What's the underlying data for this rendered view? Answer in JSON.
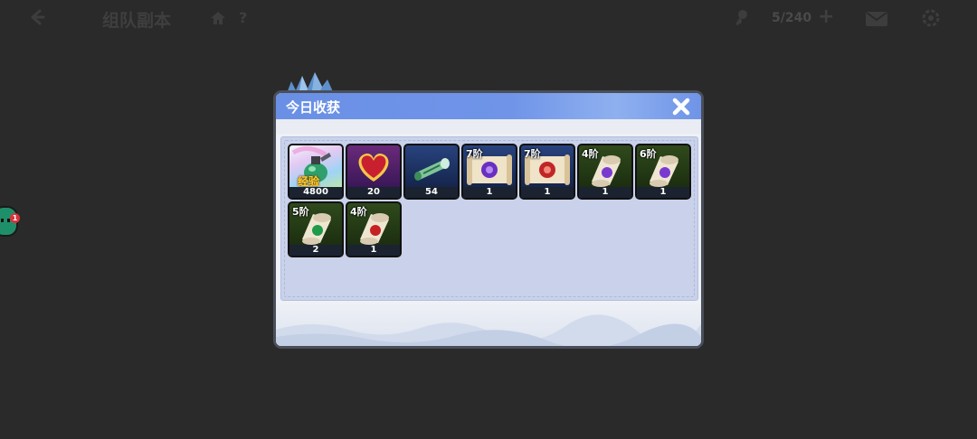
{
  "header": {
    "title": "组队副本",
    "help": "?",
    "capacity": "5/240",
    "plus": "+"
  },
  "chat": {
    "badge": "1"
  },
  "dialog": {
    "title": "今日收获",
    "items": [
      {
        "icon": "exp-potion-icon",
        "label": "经验",
        "count": "4800"
      },
      {
        "icon": "heart-icon",
        "count": "20"
      },
      {
        "icon": "green-scroll-tube-icon",
        "count": "54"
      },
      {
        "icon": "purple-seal-scroll-icon",
        "tier": "7阶",
        "count": "1"
      },
      {
        "icon": "red-seal-scroll-icon",
        "tier": "7阶",
        "count": "1"
      },
      {
        "icon": "purple-gem-scroll-icon",
        "tier": "4阶",
        "count": "1"
      },
      {
        "icon": "purple-gem-scroll-icon",
        "tier": "6阶",
        "count": "1"
      },
      {
        "icon": "green-gem-scroll-icon",
        "tier": "5阶",
        "count": "2"
      },
      {
        "icon": "red-gem-scroll-icon",
        "tier": "4阶",
        "count": "1"
      }
    ]
  }
}
